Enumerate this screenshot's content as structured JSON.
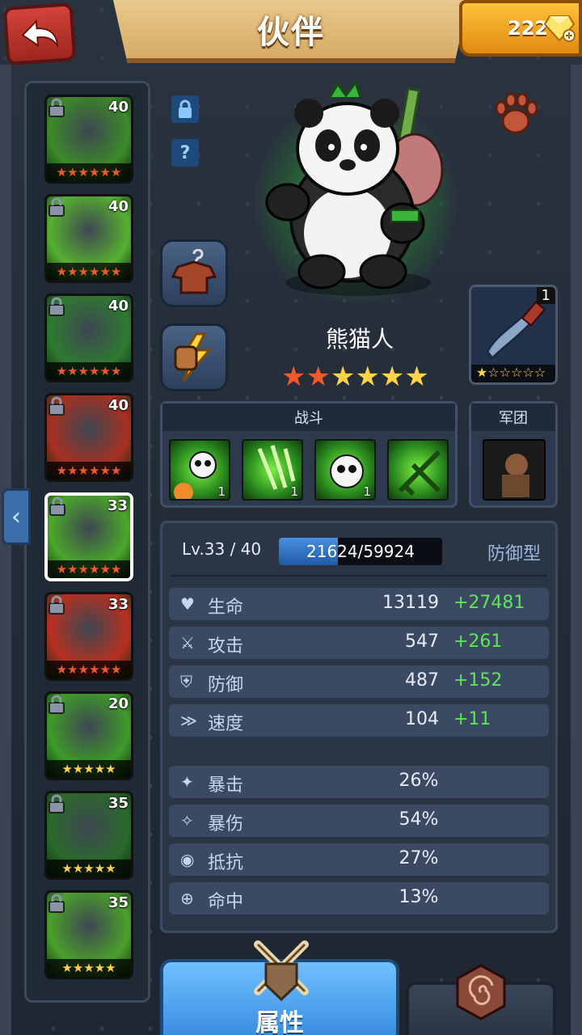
{
  "header": {
    "title": "伙伴",
    "gems": "222"
  },
  "roster": {
    "heroes": [
      {
        "level": "40",
        "stars": "★★★★★★",
        "star_color": "#f05a2a",
        "bg": "#3c8a28",
        "selected": false
      },
      {
        "level": "40",
        "stars": "★★★★★★",
        "star_color": "#f05a2a",
        "bg": "#56b030",
        "selected": false
      },
      {
        "level": "40",
        "stars": "★★★★★★",
        "star_color": "#f05a2a",
        "bg": "#2e7a30",
        "selected": false
      },
      {
        "level": "40",
        "stars": "★★★★★★",
        "star_color": "#f05a2a",
        "bg": "#a83020",
        "selected": false
      },
      {
        "level": "33",
        "stars": "★★★★★★",
        "star_color": "#f05a2a",
        "bg": "#4aa82a",
        "selected": true
      },
      {
        "level": "33",
        "stars": "★★★★★★",
        "star_color": "#f05a2a",
        "bg": "#b83020",
        "selected": false
      },
      {
        "level": "20",
        "stars": "★★★★★",
        "star_color": "#ffd24a",
        "bg": "#3e9a2a",
        "selected": false
      },
      {
        "level": "35",
        "stars": "★★★★★",
        "star_color": "#ffd24a",
        "bg": "#2a6a2a",
        "selected": false
      },
      {
        "level": "35",
        "stars": "★★★★★",
        "star_color": "#ffd24a",
        "bg": "#4aa02a",
        "selected": false
      }
    ]
  },
  "hero": {
    "name": "熊猫人",
    "stars_red": "★★",
    "stars_gold": "★★★★",
    "equip_count": "1",
    "equip_stars": "★☆☆☆☆☆"
  },
  "icons": {
    "lock": "lock-icon",
    "help": "?"
  },
  "battle_panel": {
    "title": "战斗",
    "skills": [
      {
        "count": "1"
      },
      {
        "count": "1"
      },
      {
        "count": "1"
      },
      {
        "count": ""
      }
    ]
  },
  "legion_panel": {
    "title": "军团"
  },
  "stats": {
    "level_text": "Lv.33 / 40",
    "xp_text": "21624/59924",
    "xp_fraction": 0.361,
    "type": "防御型",
    "main": [
      {
        "label": "生命",
        "value": "13119",
        "bonus": "+27481"
      },
      {
        "label": "攻击",
        "value": "547",
        "bonus": "+261"
      },
      {
        "label": "防御",
        "value": "487",
        "bonus": "+152"
      },
      {
        "label": "速度",
        "value": "104",
        "bonus": "+11"
      }
    ],
    "secondary": [
      {
        "label": "暴击",
        "value": "26%"
      },
      {
        "label": "暴伤",
        "value": "54%"
      },
      {
        "label": "抵抗",
        "value": "27%"
      },
      {
        "label": "命中",
        "value": "13%"
      }
    ]
  },
  "tabs": {
    "active": "属性"
  }
}
